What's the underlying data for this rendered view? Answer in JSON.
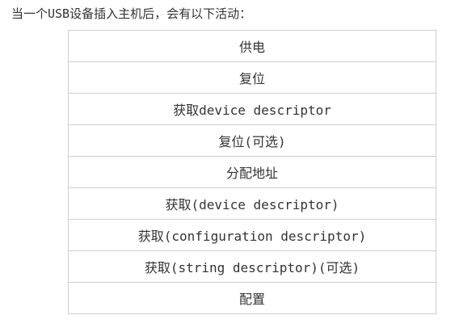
{
  "intro_text": "当一个USB设备插入主机后，会有以下活动：",
  "steps": [
    "供电",
    "复位",
    "获取device descriptor",
    "复位(可选)",
    "分配地址",
    "获取(device descriptor)",
    "获取(configuration descriptor)",
    "获取(string descriptor)(可选)",
    "配置"
  ]
}
